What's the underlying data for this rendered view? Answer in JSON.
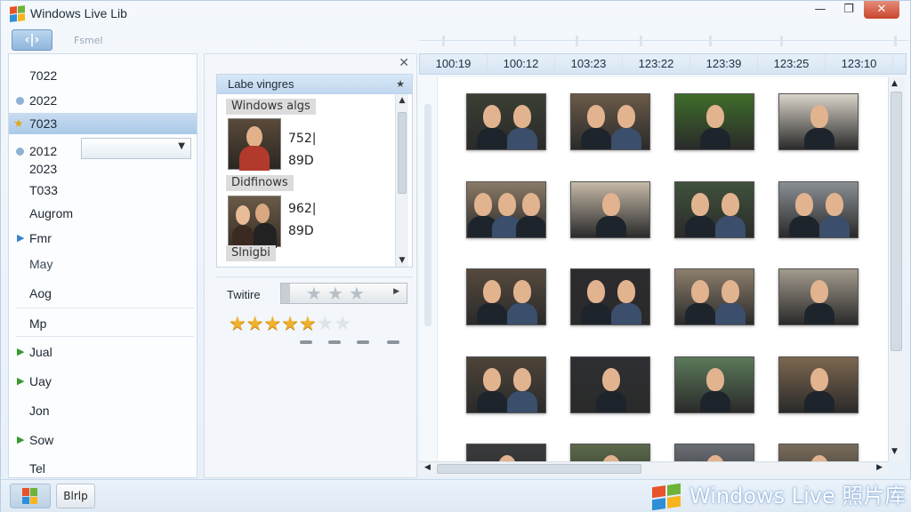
{
  "window": {
    "title": "Windows Live Lib",
    "controls": {
      "minimize": "—",
      "maximize": "❐",
      "close": "✕"
    },
    "logo_colors": [
      "#e8522a",
      "#6fb43a",
      "#2f8ed8",
      "#f7b51c"
    ]
  },
  "toolbar": {
    "back_label": "‹|›",
    "label": "Fsmel"
  },
  "nav": {
    "items": [
      {
        "label": "7022",
        "marker": ""
      },
      {
        "label": "2022",
        "marker": "dot"
      },
      {
        "label": "7023",
        "marker": "star",
        "selected": true
      },
      {
        "label": "2012",
        "marker": "dot"
      },
      {
        "label": "2023",
        "marker": ""
      },
      {
        "label": "T033",
        "marker": ""
      },
      {
        "label": "Augrom",
        "marker": ""
      },
      {
        "label": "Fmr",
        "marker": "tri-blue"
      },
      {
        "label": "May",
        "marker": ""
      },
      {
        "label": "Aog",
        "marker": ""
      },
      {
        "label": "Mp",
        "marker": ""
      },
      {
        "label": "Jual",
        "marker": "tri-green"
      },
      {
        "label": "Uay",
        "marker": "tri-green"
      },
      {
        "label": "Jon",
        "marker": ""
      },
      {
        "label": "Sow",
        "marker": "tri-green"
      },
      {
        "label": "Tel",
        "marker": ""
      }
    ]
  },
  "properties": {
    "close": "✕",
    "list_title": "Labe vingres",
    "list_title_icon": "pin-icon",
    "groups": [
      {
        "label": "Windows algs",
        "size": "752|",
        "date": "89D"
      },
      {
        "label": "Didfinows",
        "size": "962|",
        "date": "89D"
      },
      {
        "label": "Slnigbi"
      }
    ],
    "rating_label": "Twitire",
    "rating_value": 5,
    "rating_max": 7
  },
  "timeline": {
    "dates": [
      "100:19",
      "100:12",
      "103:23",
      "123:22",
      "123:39",
      "123:25",
      "123:10"
    ]
  },
  "photos": {
    "selected_index": 0,
    "items": [
      {
        "people": 2,
        "bg": "#3a3f33"
      },
      {
        "people": 2,
        "bg": "#6b5a48"
      },
      {
        "people": 1,
        "bg": "#3f6d2a"
      },
      {
        "people": 1,
        "bg": "#d9d4c8"
      },
      {
        "people": 3,
        "bg": "#8a7a66"
      },
      {
        "people": 1,
        "bg": "#c5b9a8"
      },
      {
        "people": 2,
        "bg": "#40523c"
      },
      {
        "people": 2,
        "bg": "#8a8f94"
      },
      {
        "people": 2,
        "bg": "#564a3d"
      },
      {
        "people": 2,
        "bg": "#2c2c30"
      },
      {
        "people": 2,
        "bg": "#8c7e6c"
      },
      {
        "people": 1,
        "bg": "#a39a8d"
      },
      {
        "people": 2,
        "bg": "#4e4439"
      },
      {
        "people": 1,
        "bg": "#2d2f33"
      },
      {
        "people": 1,
        "bg": "#5b7a5a"
      },
      {
        "people": 1,
        "bg": "#7d6750"
      },
      {
        "people": 1,
        "bg": "#3a3b3d"
      },
      {
        "people": 1,
        "bg": "#5c6a4a"
      },
      {
        "people": 1,
        "bg": "#6a6e73"
      },
      {
        "people": 1,
        "bg": "#7a6c5b"
      }
    ]
  },
  "bottom": {
    "button_label": "Blrlp",
    "brand": "Windows Live 照片库"
  }
}
